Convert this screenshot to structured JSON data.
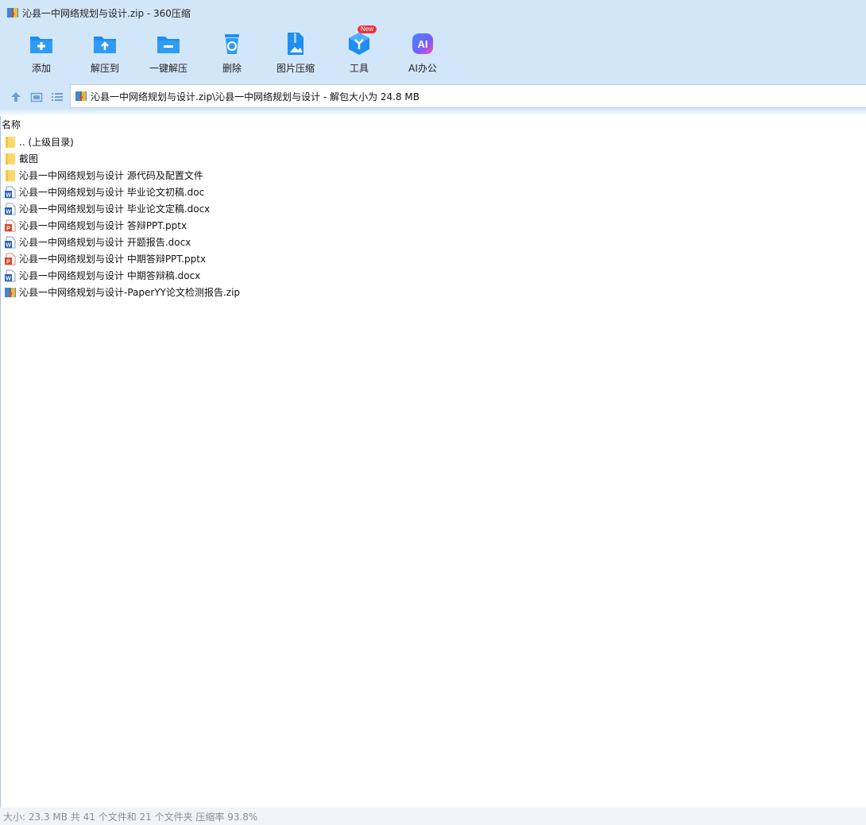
{
  "window": {
    "title": "沁县一中网络规划与设计.zip - 360压缩"
  },
  "toolbar": {
    "add": "添加",
    "extract_to": "解压到",
    "one_click_extract": "一键解压",
    "delete": "删除",
    "image_compress": "图片压缩",
    "tools": "工具",
    "tools_badge": "New",
    "ai_office": "AI办公",
    "ai_icon_text": "AI"
  },
  "nav": {
    "path": "沁县一中网络规划与设计.zip\\沁县一中网络规划与设计 - 解包大小为 24.8 MB"
  },
  "list": {
    "column_name": "名称",
    "items": [
      {
        "name": ".. (上级目录)",
        "type": "folder"
      },
      {
        "name": "截图",
        "type": "folder"
      },
      {
        "name": "沁县一中网络规划与设计 源代码及配置文件",
        "type": "folder"
      },
      {
        "name": "沁县一中网络规划与设计 毕业论文初稿.doc",
        "type": "doc"
      },
      {
        "name": "沁县一中网络规划与设计 毕业论文定稿.docx",
        "type": "docx"
      },
      {
        "name": "沁县一中网络规划与设计 答辩PPT.pptx",
        "type": "pptx"
      },
      {
        "name": "沁县一中网络规划与设计 开题报告.docx",
        "type": "docx"
      },
      {
        "name": "沁县一中网络规划与设计 中期答辩PPT.pptx",
        "type": "pptx"
      },
      {
        "name": "沁县一中网络规划与设计 中期答辩稿.docx",
        "type": "docx"
      },
      {
        "name": "沁县一中网络规划与设计-PaperYY论文检测报告.zip",
        "type": "zip"
      }
    ]
  },
  "status": {
    "text": "大小: 23.3 MB 共 41 个文件和 21 个文件夹 压缩率 93.8%"
  },
  "colors": {
    "chrome": "#d2e6fa",
    "tool_blue": "#1e8ef0",
    "word_blue": "#2b5fb8",
    "ppt_red": "#d9472b",
    "folder_yellow": "#ffd86b"
  }
}
